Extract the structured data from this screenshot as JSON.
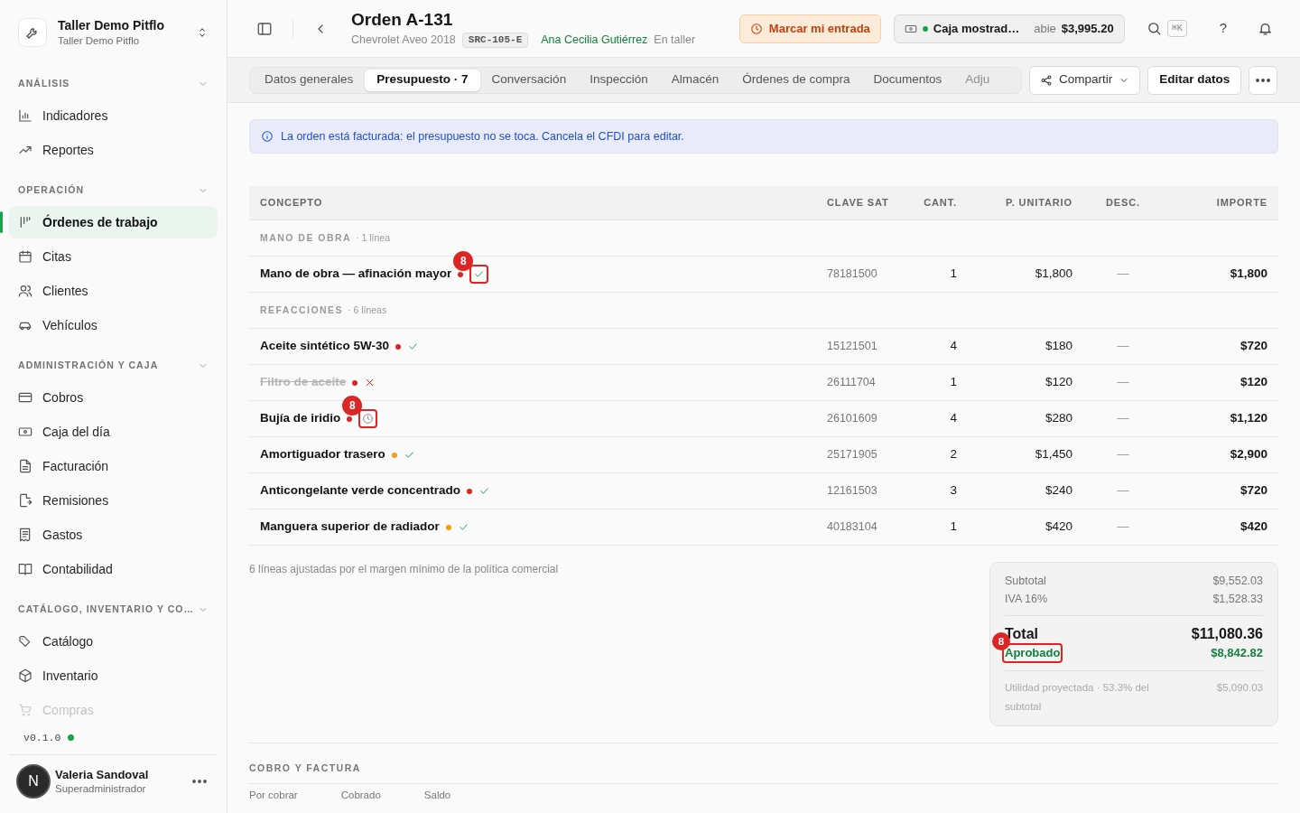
{
  "workspace": {
    "name": "Taller Demo Pitflo",
    "subtitle": "Taller Demo Pitflo"
  },
  "sidebar": {
    "sections": [
      {
        "title": "ANÁLISIS",
        "expanded": true,
        "items": [
          {
            "label": "Indicadores",
            "selected": false
          },
          {
            "label": "Reportes",
            "selected": false
          }
        ]
      },
      {
        "title": "OPERACIÓN",
        "expanded": true,
        "items": [
          {
            "label": "Órdenes de trabajo",
            "selected": true
          },
          {
            "label": "Citas",
            "selected": false
          },
          {
            "label": "Clientes",
            "selected": false
          },
          {
            "label": "Vehículos",
            "selected": false
          }
        ]
      },
      {
        "title": "ADMINISTRACIÓN Y CAJA",
        "expanded": true,
        "items": [
          {
            "label": "Cobros",
            "selected": false
          },
          {
            "label": "Caja del día",
            "selected": false
          },
          {
            "label": "Facturación",
            "selected": false
          },
          {
            "label": "Remisiones",
            "selected": false
          },
          {
            "label": "Gastos",
            "selected": false
          },
          {
            "label": "Contabilidad",
            "selected": false
          }
        ]
      },
      {
        "title": "CATÁLOGO, INVENTARIO Y CO…",
        "expanded": true,
        "items": [
          {
            "label": "Catálogo",
            "selected": false
          },
          {
            "label": "Inventario",
            "selected": false
          },
          {
            "label": "Compras",
            "selected": false
          }
        ]
      }
    ],
    "version": "v0.1.0"
  },
  "user": {
    "initial": "N",
    "name": "Valeria Sandoval",
    "role": "Superadministrador"
  },
  "header": {
    "title": "Orden A-131",
    "vehicle": "Chevrolet Aveo 2018",
    "plate": "SRC-105-E",
    "customer": "Ana Cecilia Gutiérrez",
    "status": "En taller",
    "check_in_button": "Marcar mi entrada",
    "cash": {
      "name": "Caja mostrad…",
      "state": "abie",
      "amount": "$3,995.20"
    },
    "shortcut": "⌘K",
    "help": "?"
  },
  "tabs": [
    {
      "label": "Datos generales",
      "selected": false
    },
    {
      "label": "Presupuesto · 7",
      "selected": true
    },
    {
      "label": "Conversación",
      "selected": false
    },
    {
      "label": "Inspección",
      "selected": false
    },
    {
      "label": "Almacén",
      "selected": false
    },
    {
      "label": "Órdenes de compra",
      "selected": false
    },
    {
      "label": "Documentos",
      "selected": false
    },
    {
      "label": "Adju",
      "selected": false
    }
  ],
  "actions": {
    "share": "Compartir",
    "edit": "Editar datos"
  },
  "alert": "La orden está facturada: el presupuesto no se toca. Cancela el CFDI para editar.",
  "table": {
    "columns": [
      "CONCEPTO",
      "CLAVE SAT",
      "CANT.",
      "P. UNITARIO",
      "DESC.",
      "IMPORTE"
    ],
    "groups": [
      {
        "title": "MANO DE OBRA",
        "count": "· 1 línea",
        "rows": [
          {
            "concept": "Mano de obra — afinación mayor",
            "color": "#dc2626",
            "kind": "approved",
            "annotation": "8",
            "clave": "78181500",
            "qty": "1",
            "unit": "$1,800",
            "discount": "—",
            "amount": "$1,800"
          }
        ]
      },
      {
        "title": "REFACCIONES",
        "count": "· 6 líneas",
        "rows": [
          {
            "concept": "Aceite sintético 5W-30",
            "color": "#dc2626",
            "kind": "approved",
            "clave": "15121501",
            "qty": "4",
            "unit": "$180",
            "discount": "—",
            "amount": "$720"
          },
          {
            "concept": "Filtro de aceite",
            "color": "#dc2626",
            "kind": "rejected",
            "clave": "26111704",
            "qty": "1",
            "unit": "$120",
            "discount": "—",
            "amount": "$120"
          },
          {
            "concept": "Bujía de iridio",
            "color": "#dc2626",
            "kind": "pending",
            "annotation": "8",
            "clave": "26101609",
            "qty": "4",
            "unit": "$280",
            "discount": "—",
            "amount": "$1,120"
          },
          {
            "concept": "Amortiguador trasero",
            "color": "#f59e0b",
            "kind": "approved",
            "clave": "25171905",
            "qty": "2",
            "unit": "$1,450",
            "discount": "—",
            "amount": "$2,900"
          },
          {
            "concept": "Anticongelante verde concentrado",
            "color": "#dc2626",
            "kind": "approved",
            "clave": "12161503",
            "qty": "3",
            "unit": "$240",
            "discount": "—",
            "amount": "$720"
          },
          {
            "concept": "Manguera superior de radiador",
            "color": "#f59e0b",
            "kind": "approved",
            "clave": "40183104",
            "qty": "1",
            "unit": "$420",
            "discount": "—",
            "amount": "$420"
          }
        ]
      }
    ]
  },
  "footnote": "6 líneas ajustadas por el margen mínimo de la política comercial",
  "totals": {
    "subtotal": {
      "label": "Subtotal",
      "value": "$9,552.03"
    },
    "tax": {
      "label": "IVA 16%",
      "value": "$1,528.33"
    },
    "total": {
      "label": "Total",
      "value": "$11,080.36"
    },
    "approved": {
      "label": "Aprobado",
      "value": "$8,842.82",
      "annotation": "8"
    },
    "profit": {
      "label": "Utilidad proyectada · 53.3% del subtotal",
      "value": "$5,090.03"
    }
  },
  "billing": {
    "title": "COBRO Y FACTURA",
    "labels": [
      "Por cobrar",
      "Cobrado",
      "Saldo"
    ]
  }
}
